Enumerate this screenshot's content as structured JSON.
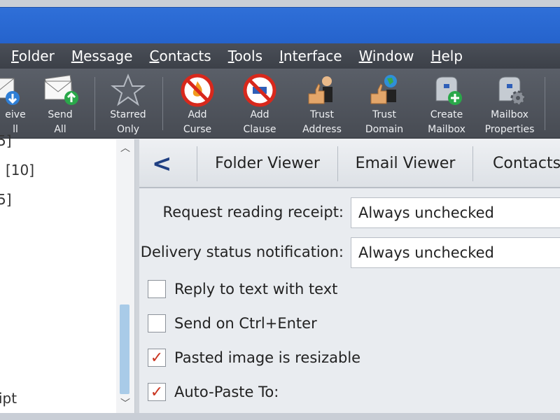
{
  "menu": {
    "items": [
      {
        "label": "Folder",
        "u": "F"
      },
      {
        "label": "Message",
        "u": "M"
      },
      {
        "label": "Contacts",
        "u": "C"
      },
      {
        "label": "Tools",
        "u": "T"
      },
      {
        "label": "Interface",
        "u": "I"
      },
      {
        "label": "Window",
        "u": "W"
      },
      {
        "label": "Help",
        "u": "H"
      }
    ]
  },
  "toolbar": {
    "receive_all": {
      "line1": "eive",
      "line2": "ll",
      "icon": "receive-mail-icon"
    },
    "send_all": {
      "line1": "Send",
      "line2": "All",
      "icon": "send-mail-icon"
    },
    "starred_only": {
      "line1": "Starred",
      "line2": "Only",
      "icon": "star-icon"
    },
    "add_curse": {
      "line1": "Add",
      "line2": "Curse",
      "icon": "no-fire-icon"
    },
    "add_clause": {
      "line1": "Add",
      "line2": "Clause",
      "icon": "no-sign-icon"
    },
    "trust_address": {
      "line1": "Trust",
      "line2": "Address",
      "icon": "thumbs-up-person-icon"
    },
    "trust_domain": {
      "line1": "Trust",
      "line2": "Domain",
      "icon": "thumbs-up-globe-icon"
    },
    "create_mailbox": {
      "line1": "Create",
      "line2": "Mailbox",
      "icon": "mailbox-add-icon"
    },
    "mailbox_properties": {
      "line1": "Mailbox",
      "line2": "Properties",
      "icon": "mailbox-gear-icon"
    }
  },
  "left_pane": {
    "fragment1": "5]",
    "fragment2": "[10]",
    "fragment3": "5]",
    "fragment4": "ipt"
  },
  "tabs": {
    "back": "<",
    "folder_viewer": "Folder Viewer",
    "email_viewer": "Email Viewer",
    "contacts": "Contacts"
  },
  "settings": {
    "reading_receipt_label": "Request reading receipt:",
    "reading_receipt_value": "Always unchecked",
    "delivery_status_label": "Delivery status notification:",
    "delivery_status_value": "Always unchecked",
    "checkboxes": [
      {
        "label": "Reply to text with text",
        "checked": false,
        "mark": ""
      },
      {
        "label": "Send on Ctrl+Enter",
        "checked": false,
        "mark": ""
      },
      {
        "label": "Pasted image is resizable",
        "checked": true,
        "mark": "✓"
      },
      {
        "label": "Auto-Paste To:",
        "checked": true,
        "mark": "✓"
      }
    ]
  },
  "colors": {
    "titlebar": "#2563cc",
    "menubar": "#3c4048",
    "toolbar": "#474b53",
    "back_arrow": "#1f3f82",
    "check": "#c9341f",
    "scroll_thumb": "#a9cbe8"
  }
}
